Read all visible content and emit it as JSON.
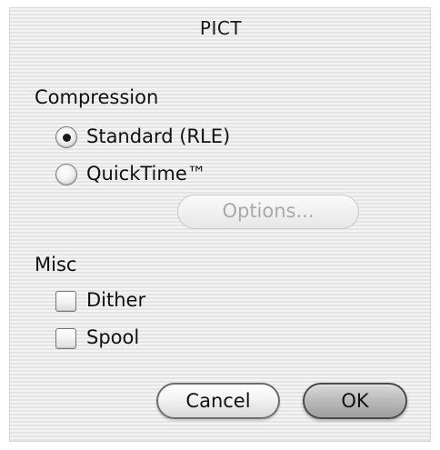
{
  "window": {
    "title": "PICT"
  },
  "compression": {
    "label": "Compression",
    "options": [
      {
        "label": "Standard (RLE)",
        "selected": true
      },
      {
        "label": "QuickTime™",
        "selected": false
      }
    ],
    "options_button": {
      "label": "Options...",
      "enabled": false
    }
  },
  "misc": {
    "label": "Misc",
    "checkboxes": [
      {
        "label": "Dither",
        "checked": false
      },
      {
        "label": "Spool",
        "checked": false
      }
    ]
  },
  "actions": {
    "cancel_label": "Cancel",
    "ok_label": "OK"
  }
}
